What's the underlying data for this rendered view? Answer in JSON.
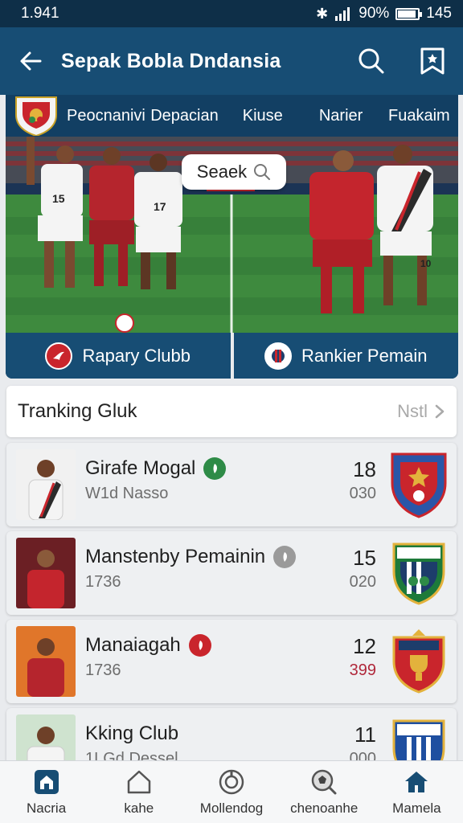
{
  "status": {
    "time": "1.941",
    "battery_text": "90%",
    "extra": "145",
    "battery_level": 0.9
  },
  "app_bar": {
    "title": "Sepak Bobla Dndansia"
  },
  "tabs": [
    {
      "label": "Peocnanivi"
    },
    {
      "label": "Depacian"
    },
    {
      "label": "Kiuse"
    },
    {
      "label": "Narier"
    },
    {
      "label": "Fuakaim"
    }
  ],
  "hero": {
    "search_label": "Seaek",
    "player_numbers": [
      "15",
      "",
      "17",
      "",
      "10"
    ],
    "left_button": "Rapary Clubb",
    "right_button": "Rankier Pemain"
  },
  "section": {
    "title": "Tranking Gluk",
    "more": "Nstl"
  },
  "rows": [
    {
      "name": "Girafe Mogal",
      "sub": "W1d Nasso",
      "num": "18",
      "sub_num": "030",
      "badge_color": "#2e8b47",
      "crest_color": "#2a56a8",
      "sub_num_color": "#6e6e6e"
    },
    {
      "name": "Manstenby Pemainin",
      "sub": "1736",
      "num": "15",
      "sub_num": "020",
      "badge_color": "#9a9a9a",
      "crest_color": "#1d7a3a",
      "sub_num_color": "#6e6e6e"
    },
    {
      "name": "Manaiagah",
      "sub": "1736",
      "num": "12",
      "sub_num": "399",
      "badge_color": "#c9252c",
      "crest_color": "#c9252c",
      "sub_num_color": "#b0283b"
    },
    {
      "name": "Kking Club",
      "sub": "1LGd Dessel",
      "num": "11",
      "sub_num": "000",
      "badge_color": "",
      "crest_color": "#1f4fa0",
      "sub_num_color": "#6e6e6e"
    }
  ],
  "nav": [
    {
      "label": "Nacria",
      "icon": "lock-home-icon"
    },
    {
      "label": "kahe",
      "icon": "home-outline-icon"
    },
    {
      "label": "Mollendog",
      "icon": "target-icon"
    },
    {
      "label": "chenoanhe",
      "icon": "ball-search-icon"
    },
    {
      "label": "Mamela",
      "icon": "home-filled-icon"
    }
  ],
  "colors": {
    "primary": "#174d74",
    "status": "#0e2f48",
    "accent_red": "#c9252c",
    "accent_green": "#2e8b47"
  }
}
